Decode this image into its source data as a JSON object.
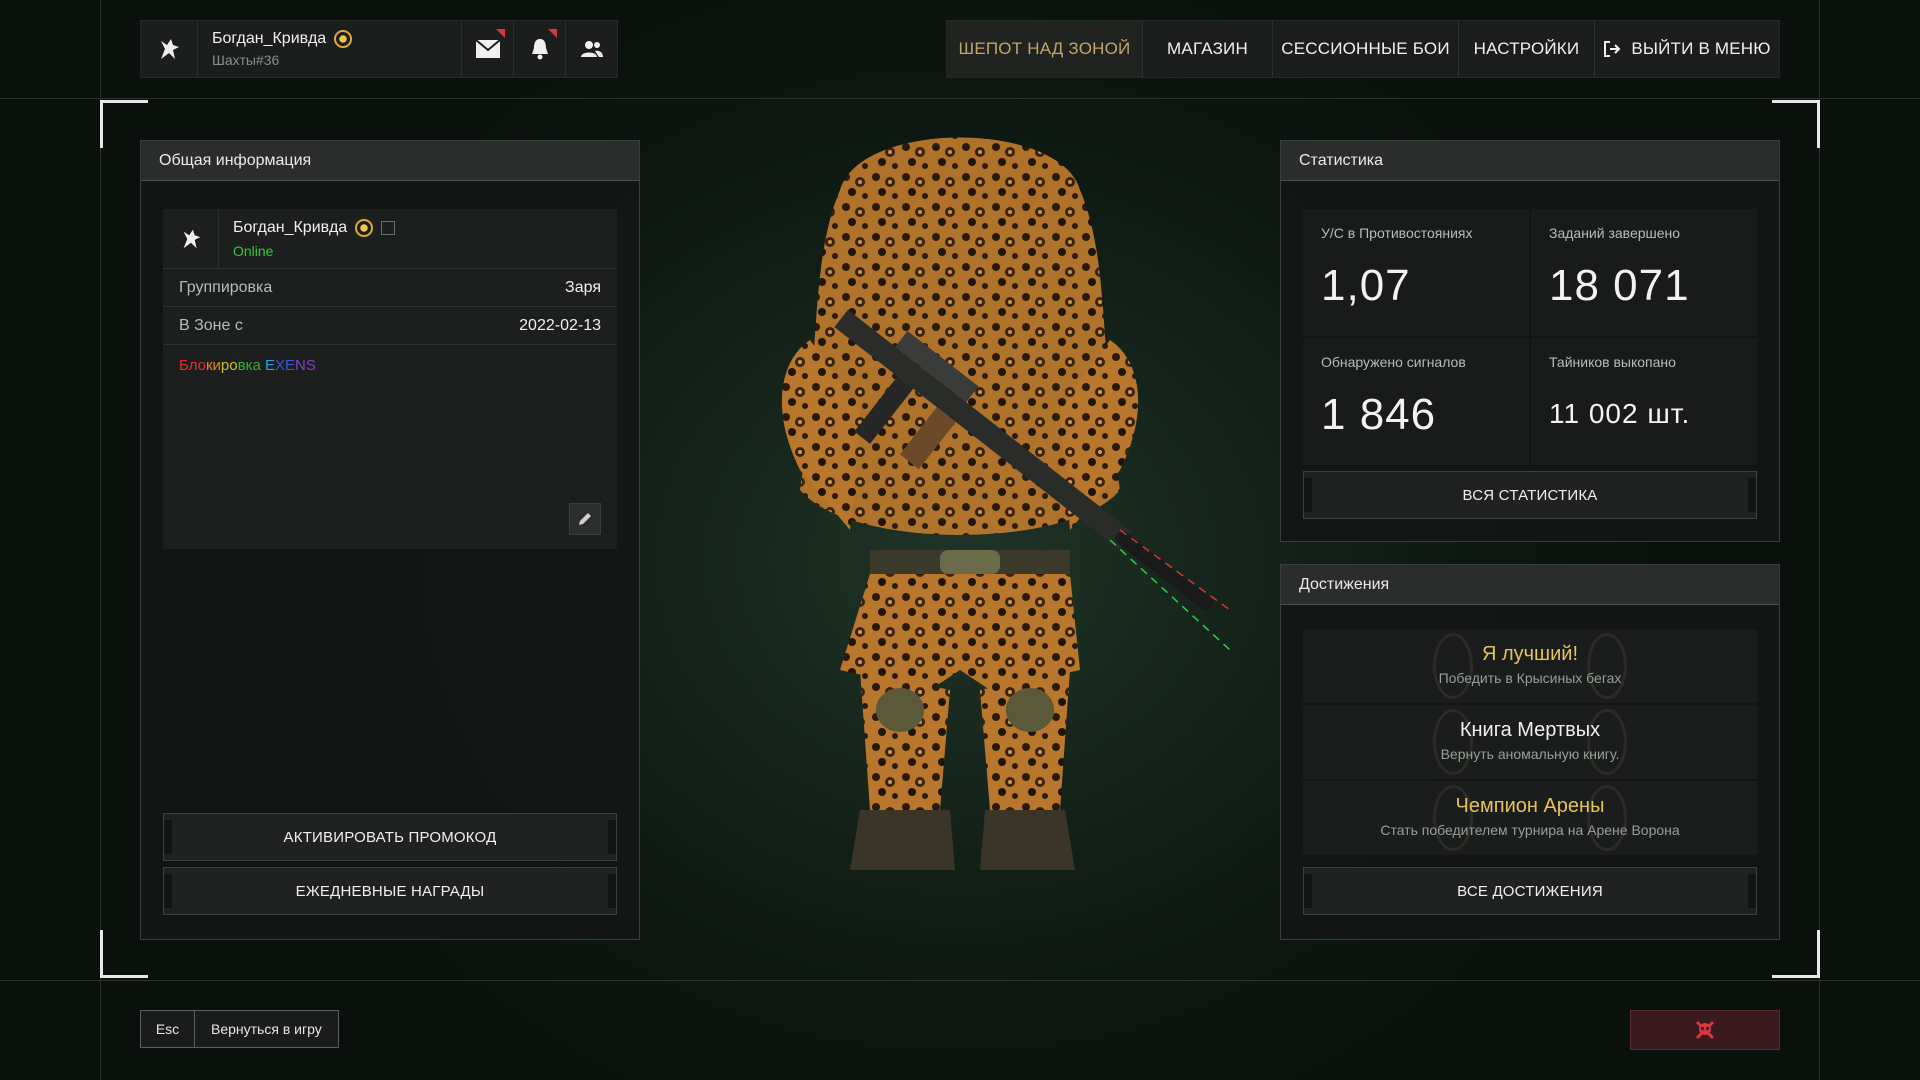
{
  "profile": {
    "name": "Богдан_Кривда",
    "server": "Шахты#36",
    "icons": [
      "wolf-icon",
      "sun-badge-icon",
      "mail-icon",
      "bell-icon",
      "friends-icon"
    ]
  },
  "nav": {
    "items": [
      {
        "label": "ШЕПОТ НАД ЗОНОЙ",
        "active": true
      },
      {
        "label": "МАГАЗИН",
        "active": false
      },
      {
        "label": "СЕССИОННЫЕ БОИ",
        "active": false
      },
      {
        "label": "НАСТРОЙКИ",
        "active": false
      },
      {
        "label": "ВЫЙТИ В МЕНЮ",
        "active": false
      }
    ]
  },
  "general": {
    "title": "Общая информация",
    "user": {
      "name": "Богдан_Кривда",
      "status": "Online"
    },
    "rows": [
      {
        "key": "Группировка",
        "value": "Заря"
      },
      {
        "key": "В Зоне с",
        "value": "2022-02-13"
      }
    ],
    "bio_rainbow_text": "Блокировка EXENS",
    "bio_colors": [
      "#e0312f",
      "#e08a2f",
      "#c8c02e",
      "#34b03a",
      "#2a9fd8",
      "#3456d8",
      "#8a3ad8"
    ],
    "buttons": {
      "promo": "АКТИВИРОВАТЬ ПРОМОКОД",
      "daily": "ЕЖЕДНЕВНЫЕ НАГРАДЫ"
    }
  },
  "stats": {
    "title": "Статистика",
    "items": [
      {
        "label": "У/С в Противостояниях",
        "value": "1,07"
      },
      {
        "label": "Заданий завершено",
        "value": "18 071"
      },
      {
        "label": "Обнаружено сигналов",
        "value": "1 846"
      },
      {
        "label": "Тайников выкопано",
        "value": "11 002 шт."
      }
    ],
    "all_button": "ВСЯ СТАТИСТИКА"
  },
  "achievements": {
    "title": "Достижения",
    "items": [
      {
        "title": "Я лучший!",
        "desc": "Победить в Крысиных бегах",
        "color": "#e6c25a"
      },
      {
        "title": "Книга Мертвых",
        "desc": "Вернуть аномальную книгу.",
        "color": "#f0f0f0"
      },
      {
        "title": "Чемпион Арены",
        "desc": "Стать победителем турнира на Арене Ворона",
        "color": "#e6c25a"
      }
    ],
    "all_button": "ВСЕ ДОСТИЖЕНИЯ"
  },
  "footer": {
    "esc_key": "Esc",
    "esc_label": "Вернуться в игру"
  },
  "colors": {
    "accent_gold": "#c2a568",
    "online_green": "#35c93a",
    "danger": "#d9363e"
  }
}
